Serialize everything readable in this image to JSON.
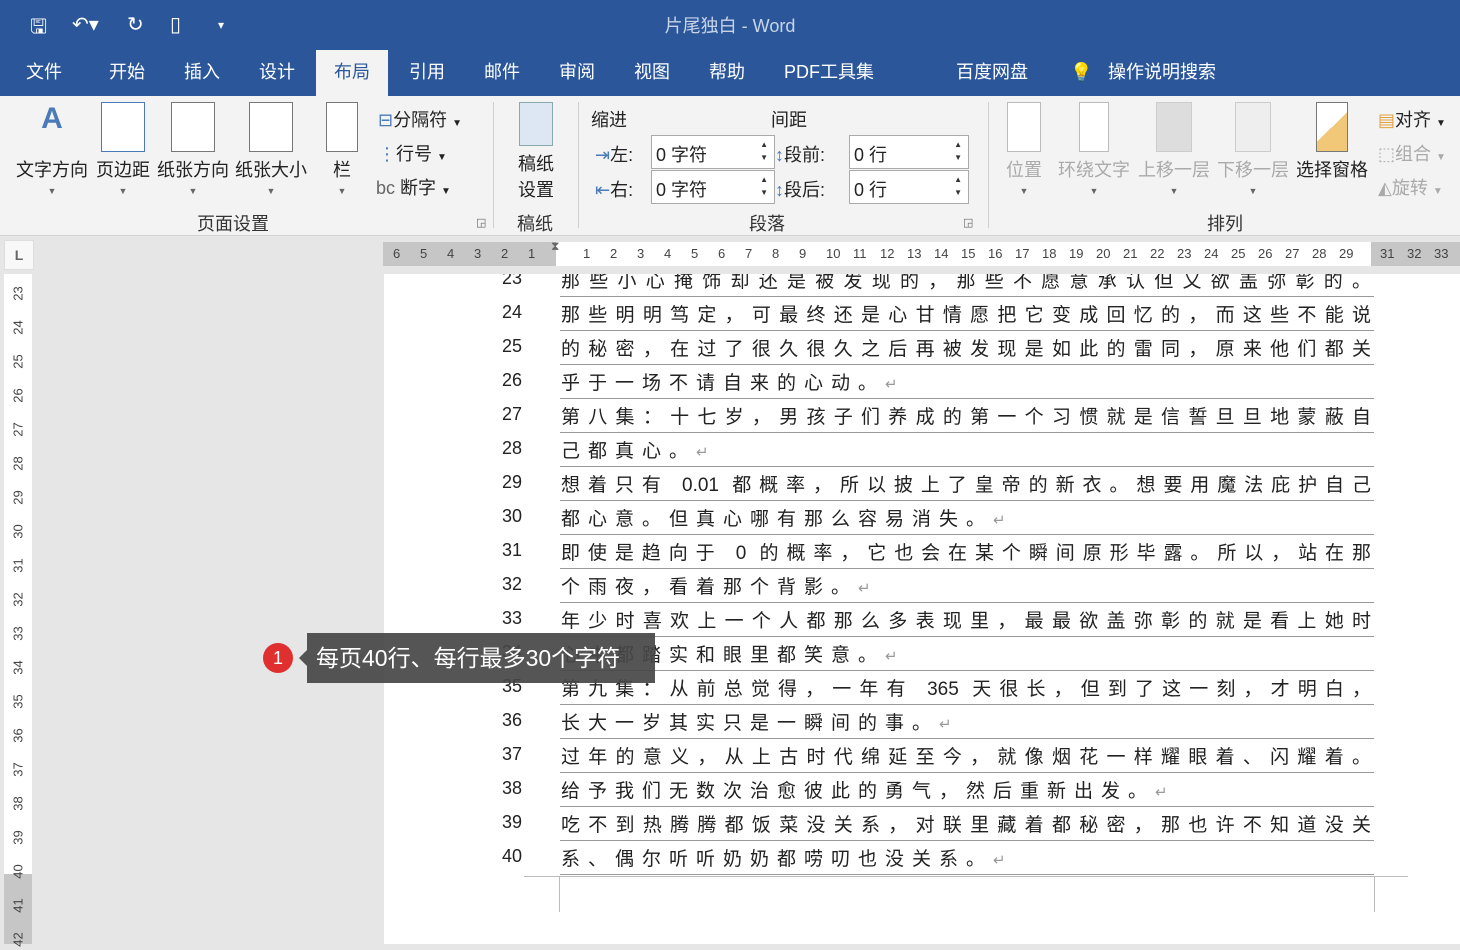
{
  "titlebar": {
    "title": "片尾独白 - Word",
    "quick_access": [
      "save-icon",
      "undo-icon",
      "redo-icon",
      "touch-mode-icon",
      "customize-icon"
    ]
  },
  "tabs": [
    {
      "label": "文件"
    },
    {
      "label": "开始"
    },
    {
      "label": "插入"
    },
    {
      "label": "设计"
    },
    {
      "label": "布局",
      "active": true
    },
    {
      "label": "引用"
    },
    {
      "label": "邮件"
    },
    {
      "label": "审阅"
    },
    {
      "label": "视图"
    },
    {
      "label": "帮助"
    },
    {
      "label": "PDF工具集"
    },
    {
      "label": "百度网盘"
    },
    {
      "label": "操作说明搜索"
    }
  ],
  "ribbon": {
    "page_setup": {
      "label": "页面设置",
      "text_direction": "文字方向",
      "margins": "页边距",
      "orientation": "纸张方向",
      "size": "纸张大小",
      "columns": "栏",
      "breaks": "分隔符",
      "line_numbers": "行号",
      "hyphenation": "断字"
    },
    "manuscript": {
      "label": "稿纸",
      "button_line1": "稿纸",
      "button_line2": "设置"
    },
    "paragraph": {
      "label": "段落",
      "indent": "缩进",
      "spacing": "间距",
      "left_label": "左:",
      "left_value": "0 字符",
      "right_label": "右:",
      "right_value": "0 字符",
      "before_label": "段前:",
      "before_value": "0 行",
      "after_label": "段后:",
      "after_value": "0 行"
    },
    "arrange": {
      "label": "排列",
      "position": "位置",
      "wrap_text": "环绕文字",
      "bring_forward": "上移一层",
      "send_backward": "下移一层",
      "selection_pane": "选择窗格",
      "align": "对齐",
      "group": "组合",
      "rotate": "旋转"
    }
  },
  "ruler": {
    "negative": [
      "6",
      "5",
      "4",
      "3",
      "2",
      "1"
    ],
    "positive": [
      "1",
      "2",
      "3",
      "4",
      "5",
      "6",
      "7",
      "8",
      "9",
      "10",
      "11",
      "12",
      "13",
      "14",
      "15",
      "16",
      "17",
      "18",
      "19",
      "20",
      "21",
      "22",
      "23",
      "24",
      "25",
      "26",
      "27",
      "28",
      "29"
    ],
    "right": [
      "31",
      "32",
      "33"
    ],
    "vertical": [
      "23",
      "24",
      "25",
      "26",
      "27",
      "28",
      "29",
      "30",
      "31",
      "32",
      "33",
      "34",
      "35",
      "36",
      "37",
      "38",
      "39",
      "40",
      "41",
      "42"
    ]
  },
  "document": {
    "lines": [
      {
        "n": "23",
        "text": "那些小心掩饰却还是被发现的，那些不愿意承认但又欲盖弥彰的。",
        "full": true
      },
      {
        "n": "24",
        "text": "那些明明笃定，可最终还是心甘情愿把它变成回忆的，而这些不能说",
        "full": true
      },
      {
        "n": "25",
        "text": "的秘密，在过了很久很久之后再被发现是如此的雷同，原来他们都关",
        "full": true
      },
      {
        "n": "26",
        "text": "乎于一场不请自来的心动。",
        "full": false
      },
      {
        "n": "27",
        "text": "第八集：十七岁，男孩子们养成的第一个习惯就是信誓旦旦地蒙蔽自",
        "full": true
      },
      {
        "n": "28",
        "text": "己都真心。",
        "full": false
      },
      {
        "n": "29",
        "text": "想着只有 0.01 都概率，所以披上了皇帝的新衣。想要用魔法庇护自己",
        "full": true
      },
      {
        "n": "30",
        "text": "都心意。但真心哪有那么容易消失。",
        "full": false
      },
      {
        "n": "31",
        "text": "即使是趋向于 0 的概率，它也会在某个瞬间原形毕露。所以，站在那",
        "full": true
      },
      {
        "n": "32",
        "text": "个雨夜，看着那个背影。",
        "full": false
      },
      {
        "n": "33",
        "text": "年少时喜欢上一个人都那么多表现里，最最欲盖弥彰的就是看上她时",
        "full": true
      },
      {
        "n": "34",
        "text": "心中都踏实和眼里都笑意。",
        "full": false
      },
      {
        "n": "35",
        "text": "第九集：从前总觉得，一年有 365 天很长，但到了这一刻，才明白，",
        "full": true
      },
      {
        "n": "36",
        "text": "长大一岁其实只是一瞬间的事。",
        "full": false
      },
      {
        "n": "37",
        "text": "过年的意义，从上古时代绵延至今，就像烟花一样耀眼着、闪耀着。",
        "full": true
      },
      {
        "n": "38",
        "text": "给予我们无数次治愈彼此的勇气，然后重新出发。",
        "full": false
      },
      {
        "n": "39",
        "text": "吃不到热腾腾都饭菜没关系，对联里藏着都秘密，那也许不知道没关",
        "full": true
      },
      {
        "n": "40",
        "text": "系、偶尔听听奶奶都唠叨也没关系。",
        "full": false
      }
    ],
    "paragraph_mark": "↵"
  },
  "tooltip": {
    "badge": "1",
    "text": "每页40行、每行最多30个字符"
  },
  "colors": {
    "brand": "#2b579a",
    "badge": "#e02f2f"
  }
}
